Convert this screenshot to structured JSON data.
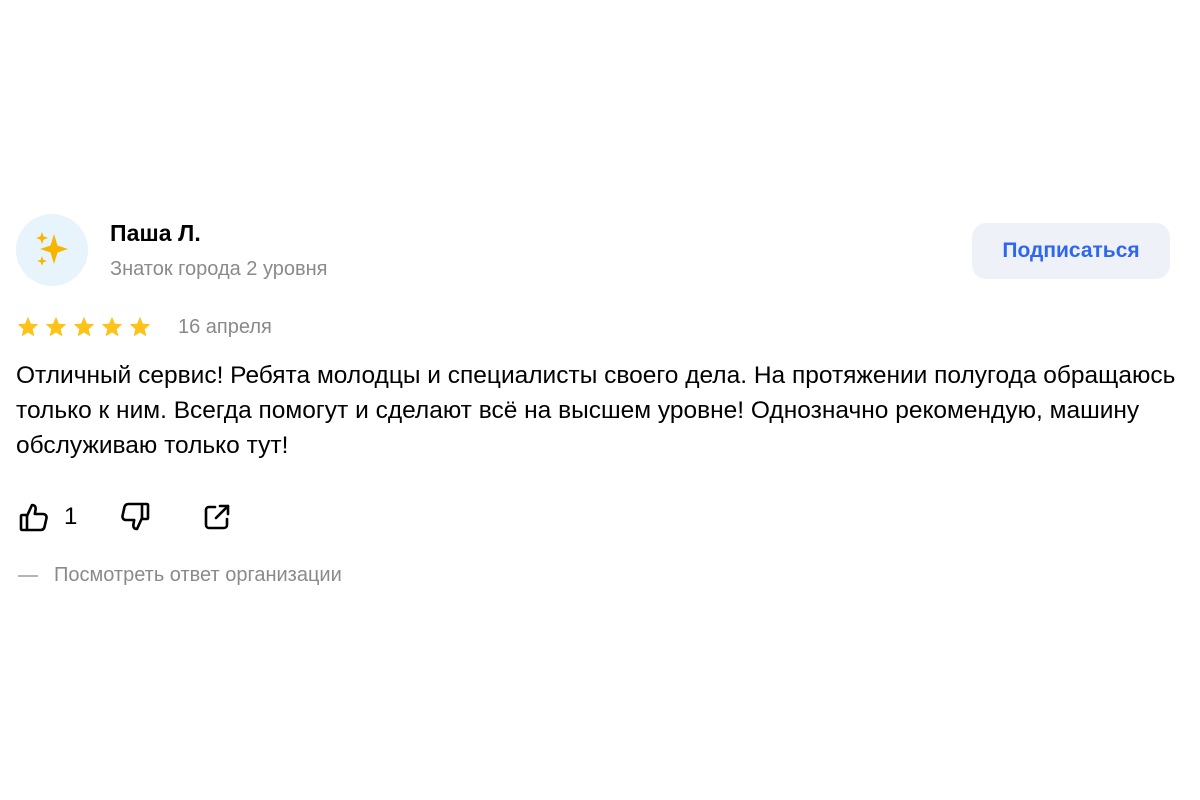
{
  "author": {
    "name": "Паша Л.",
    "level": "Знаток города 2 уровня",
    "avatar_icon": "sparkles-icon"
  },
  "subscribe": {
    "label": "Подписаться"
  },
  "rating": {
    "stars": 5,
    "max": 5,
    "color": "#fcc419"
  },
  "review": {
    "date": "16 апреля",
    "text": "Отличный сервис! Ребята молодцы и специалисты своего дела. На протяжении полугода обращаюсь только к ним. Всегда помогут и сделают всё на высшем уровне! Однозначно рекомендую, машину обслуживаю только тут!"
  },
  "actions": {
    "like_icon": "thumbs-up-icon",
    "like_count": "1",
    "dislike_icon": "thumbs-down-icon",
    "share_icon": "share-icon"
  },
  "org_reply": {
    "label": "Посмотреть ответ организации"
  },
  "colors": {
    "accent": "#2f66f0",
    "secondary_text": "#8a8a8a",
    "button_bg": "#eef2f8",
    "avatar_bg": "#e8f4fb"
  }
}
